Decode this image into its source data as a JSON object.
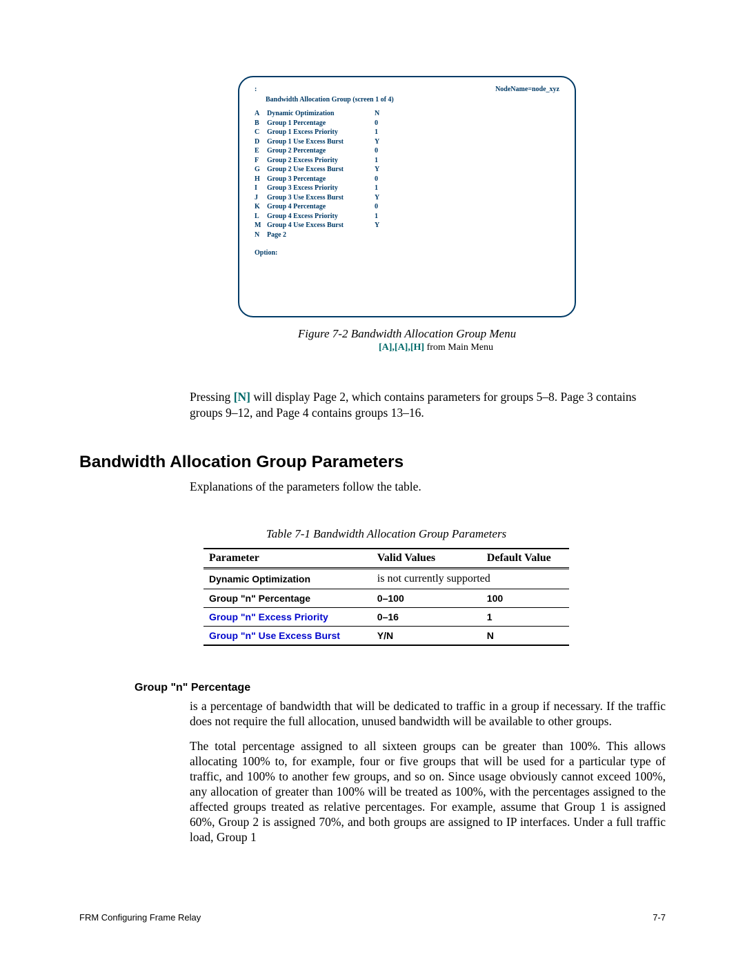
{
  "terminal": {
    "colon": ":",
    "nodename": "NodeName=node_xyz",
    "title": "Bandwidth Allocation Group (screen 1 of 4)",
    "items": [
      {
        "key": "A",
        "label": "Dynamic Optimization",
        "val": "N"
      },
      {
        "key": "B",
        "label": "Group 1 Percentage",
        "val": "0"
      },
      {
        "key": "C",
        "label": "Group 1 Excess Priority",
        "val": "1"
      },
      {
        "key": "D",
        "label": "Group 1 Use Excess Burst",
        "val": "Y"
      },
      {
        "key": "E",
        "label": "Group 2 Percentage",
        "val": "0"
      },
      {
        "key": "F",
        "label": "Group 2 Excess Priority",
        "val": "1"
      },
      {
        "key": "G",
        "label": "Group 2 Use Excess Burst",
        "val": "Y"
      },
      {
        "key": "H",
        "label": "Group 3 Percentage",
        "val": "0"
      },
      {
        "key": "I",
        "label": "Group 3 Excess Priority",
        "val": "1"
      },
      {
        "key": "J",
        "label": "Group 3 Use Excess Burst",
        "val": "Y"
      },
      {
        "key": "K",
        "label": "Group 4 Percentage",
        "val": "0"
      },
      {
        "key": "L",
        "label": "Group 4 Excess Priority",
        "val": "1"
      },
      {
        "key": "M",
        "label": "Group 4 Use Excess Burst",
        "val": "Y"
      },
      {
        "key": "N",
        "label": "Page 2",
        "val": ""
      }
    ],
    "option": "Option:"
  },
  "figure": {
    "caption": "Figure 7-2    Bandwidth Allocation Group Menu",
    "sub_path": "[A],[A],[H]",
    "sub_rest": " from Main Menu"
  },
  "press": {
    "pre": "Pressing ",
    "N": "[N]",
    "rest": " will display Page 2, which contains parameters for groups 5–8. Page 3 contains groups 9–12, and Page 4 contains groups 13–16."
  },
  "h2": "Bandwidth Allocation Group Parameters",
  "intro": "Explanations of the parameters follow the table.",
  "table": {
    "caption": "Table 7-1    Bandwidth Allocation Group Parameters",
    "headers": {
      "c1": "Parameter",
      "c2": "Valid Values",
      "c3": "Default Value"
    },
    "rows": [
      {
        "c1": "Dynamic Optimization",
        "c2": "is not currently supported",
        "c3": "",
        "link": false,
        "c2normal": true,
        "span": true
      },
      {
        "c1": "Group \"n\" Percentage",
        "c2": "0–100",
        "c3": "100",
        "link": false
      },
      {
        "c1": "Group \"n\" Excess Priority",
        "c2": "0–16",
        "c3": "1",
        "link": true
      },
      {
        "c1": "Group \"n\" Use Excess Burst",
        "c2": "Y/N",
        "c3": "N",
        "link": true
      }
    ]
  },
  "h3": "Group \"n\" Percentage",
  "p1": "is a percentage of bandwidth that will be dedicated to traffic in a group if necessary. If the traffic does not require the full allocation, unused bandwidth will be available to other groups.",
  "p2": "The total percentage assigned to all sixteen groups can be greater than 100%. This allows allocating 100% to, for example, four or five groups that will be used for a particular type of traffic, and 100% to another few groups, and so on. Since usage obviously cannot exceed 100%, any allocation of greater than 100% will be treated as 100%, with the percentages assigned to the affected groups treated as relative percentages. For example, assume that Group 1 is assigned 60%, Group 2 is assigned 70%, and both groups are assigned to IP interfaces. Under a full traffic load, Group 1",
  "footer": {
    "left": "FRM Configuring Frame Relay",
    "right": "7-7"
  }
}
